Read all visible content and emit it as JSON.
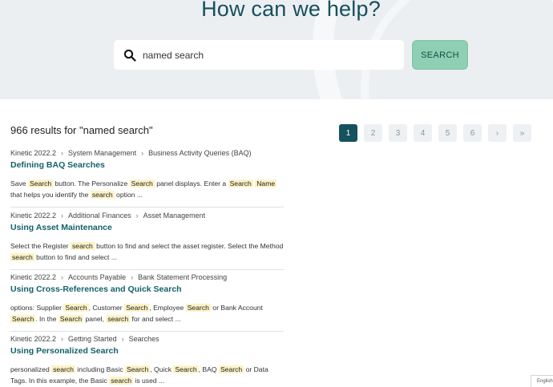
{
  "hero": {
    "title": "How can we help?"
  },
  "search": {
    "value": "named search",
    "button_label": "SEARCH"
  },
  "results": {
    "count_text": "966 results for \"named search\"",
    "items": [
      {
        "crumbs": [
          "Kinetic 2022.2",
          "System Management",
          "Business Activity Queries (BAQ)"
        ],
        "title": "Defining BAQ Searches",
        "snippet": [
          {
            "t": "Save "
          },
          {
            "t": "Search",
            "hl": true
          },
          {
            "t": " button. The Personalize "
          },
          {
            "t": "Search",
            "hl": true
          },
          {
            "t": " panel displays. Enter a "
          },
          {
            "t": "Search",
            "hl": true
          },
          {
            "t": " "
          },
          {
            "t": "Name",
            "hl": true
          },
          {
            "t": " that helps you identify the "
          },
          {
            "t": "search",
            "hl": true
          },
          {
            "t": " option ..."
          }
        ]
      },
      {
        "crumbs": [
          "Kinetic 2022.2",
          "Additional Finances",
          "Asset Management"
        ],
        "title": "Using Asset Maintenance",
        "snippet": [
          {
            "t": "Select the Register "
          },
          {
            "t": "search",
            "hl": true
          },
          {
            "t": " button to find and select the asset register. Select the Method "
          },
          {
            "t": "search",
            "hl": true
          },
          {
            "t": " button to find and select ..."
          }
        ]
      },
      {
        "crumbs": [
          "Kinetic 2022.2",
          "Accounts Payable",
          "Bank Statement Processing"
        ],
        "title": "Using Cross-References and Quick Search",
        "snippet": [
          {
            "t": "options: Supplier "
          },
          {
            "t": "Search",
            "hl": true
          },
          {
            "t": ", Customer "
          },
          {
            "t": "Search",
            "hl": true
          },
          {
            "t": ", Employee "
          },
          {
            "t": "Search",
            "hl": true
          },
          {
            "t": " or Bank Account "
          },
          {
            "t": "Search",
            "hl": true
          },
          {
            "t": ". In the "
          },
          {
            "t": "Search",
            "hl": true
          },
          {
            "t": " panel, "
          },
          {
            "t": "search",
            "hl": true
          },
          {
            "t": " for and select ..."
          }
        ]
      },
      {
        "crumbs": [
          "Kinetic 2022.2",
          "Getting Started",
          "Searches"
        ],
        "title": "Using Personalized Search",
        "snippet": [
          {
            "t": "personalized "
          },
          {
            "t": "search",
            "hl": true
          },
          {
            "t": " including Basic "
          },
          {
            "t": "Search",
            "hl": true
          },
          {
            "t": ", Quick "
          },
          {
            "t": "Search",
            "hl": true
          },
          {
            "t": ", BAQ "
          },
          {
            "t": "Search",
            "hl": true
          },
          {
            "t": " or Data Tags. In this example, the Basic "
          },
          {
            "t": "search",
            "hl": true
          },
          {
            "t": " is used ..."
          }
        ]
      }
    ]
  },
  "pagination": {
    "pages": [
      "1",
      "2",
      "3",
      "4",
      "5",
      "6"
    ],
    "active_page": "1",
    "next_label": "›",
    "last_label": "»"
  },
  "footer": {
    "language_label": "English"
  },
  "colors": {
    "brand_teal": "#14525e",
    "search_button": "#8fcfb3",
    "highlight": "#fdf3c7"
  },
  "icons": {
    "search": "search-icon"
  }
}
